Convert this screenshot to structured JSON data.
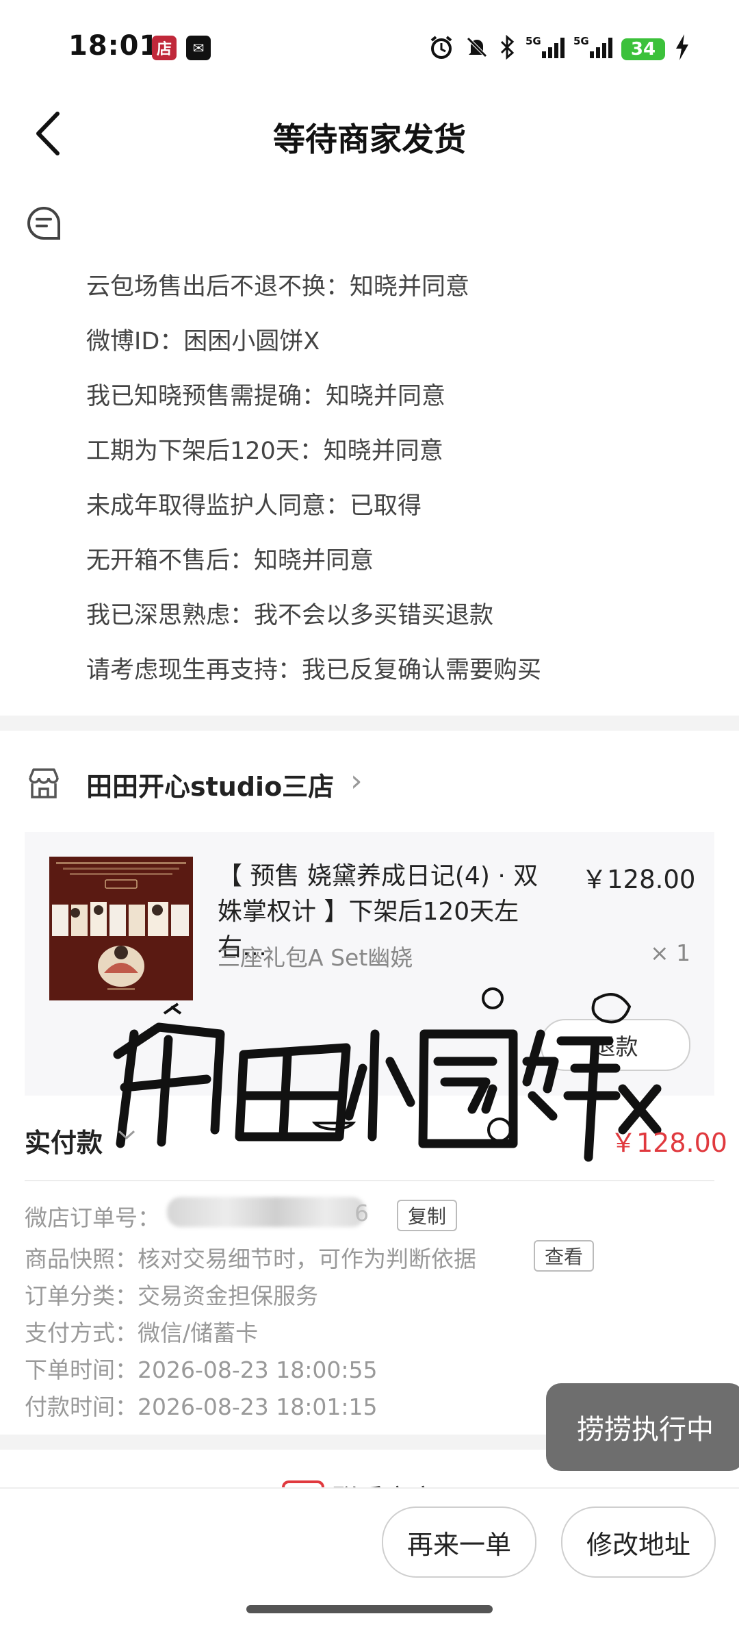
{
  "status_bar": {
    "time": "18:01",
    "app1": "店",
    "app2": "✉",
    "net1": "5G",
    "net2": "5G",
    "battery": "34"
  },
  "header": {
    "title": "等待商家发货"
  },
  "notes": [
    "云包场售出后不退不换：知晓并同意",
    "微博ID：困困小圆饼X",
    "我已知晓预售需提确：知晓并同意",
    "工期为下架后120天：知晓并同意",
    "未成年取得监护人同意：已取得",
    "无开箱不售后：知晓并同意",
    "我已深思熟虑：我不会以多买错买退款",
    "请考虑现生再支持：我已反复确认需要购买"
  ],
  "store": {
    "name": "田田开心studio三店"
  },
  "product": {
    "title": "【 预售 娆黛养成日记(4) · 双姝掌权计 】下架后120天左右…",
    "price": "￥128.00",
    "spec": "三座礼包A Set幽娆",
    "qty": "× 1",
    "refund_label": "退款"
  },
  "watermark": {
    "text": "田田小圆饼X"
  },
  "payment": {
    "paid_label": "实付款",
    "paid_amount": "￥128.00"
  },
  "info": {
    "order_no_label": "微店订单号：",
    "order_no_tail": "6",
    "copy_label": "复制",
    "snapshot_label": "商品快照：",
    "snapshot_value": "核对交易细节时，可作为判断依据",
    "view_label": "查看",
    "category_label": "订单分类：",
    "category_value": "交易资金担保服务",
    "pay_method_label": "支付方式：",
    "pay_method_value": "微信/储蓄卡",
    "order_time_label": "下单时间：",
    "order_time_value": "2026-08-23 18:00:55",
    "pay_time_label": "付款时间：",
    "pay_time_value": "2026-08-23 18:01:15"
  },
  "toast": {
    "text": "捞捞执行中"
  },
  "contact": {
    "label": "联系商家"
  },
  "bottom": {
    "reorder_label": "再来一单",
    "edit_address_label": "修改地址"
  },
  "colors": {
    "accent": "#e0393e",
    "battery": "#3cc13b",
    "thumb_bg": "#5a1a12"
  }
}
